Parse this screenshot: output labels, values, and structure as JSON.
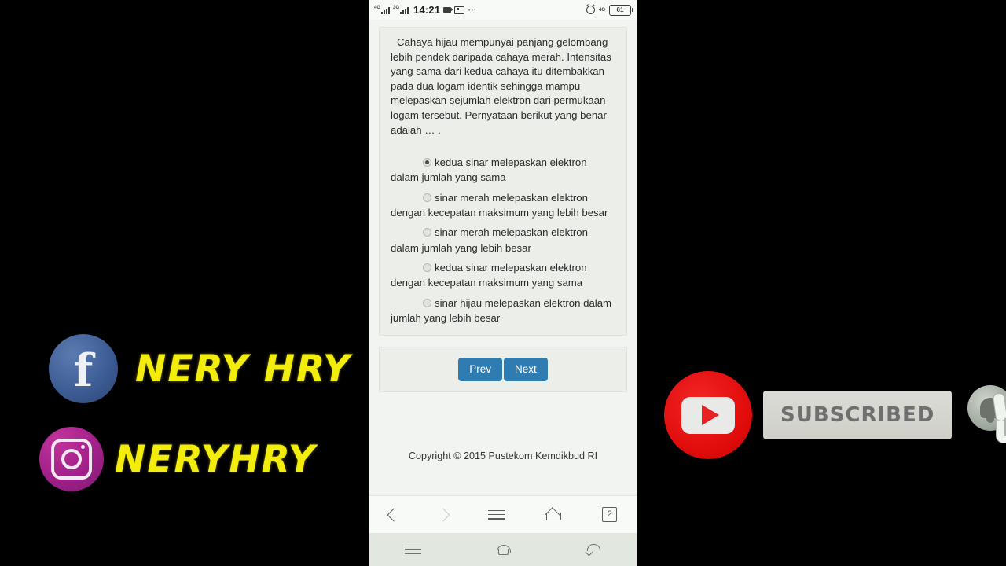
{
  "statusbar": {
    "sim1_network": "4G",
    "sim2_network": "3G",
    "clock": "14:21",
    "overflow_dots": "⋯",
    "right_network": "4G",
    "battery_percent": "61"
  },
  "quiz": {
    "question": "Cahaya hijau mempunyai panjang gelombang lebih pendek daripada cahaya merah. Intensitas yang sama dari kedua cahaya itu ditembakkan pada dua logam identik sehingga mampu melepaskan sejumlah elektron dari permukaan logam tersebut. Pernyataan berikut yang benar adalah … .",
    "options": [
      {
        "text": "kedua sinar melepaskan elektron dalam jumlah yang sama",
        "selected": true
      },
      {
        "text": "sinar merah melepaskan elektron dengan kecepatan maksimum yang lebih besar",
        "selected": false
      },
      {
        "text": "sinar merah melepaskan elektron dalam jumlah yang lebih besar",
        "selected": false
      },
      {
        "text": "kedua sinar melepaskan elektron dengan kecepatan maksimum yang sama",
        "selected": false
      },
      {
        "text": "sinar hijau melepaskan elektron dalam jumlah yang lebih besar",
        "selected": false
      }
    ],
    "prev_label": "Prev",
    "next_label": "Next",
    "copyright": "Copyright © 2015 Pustekom Kemdikbud RI",
    "button_color": "#2e7cb1"
  },
  "browser_bar": {
    "back_icon": "chevron-left-icon",
    "forward_icon": "chevron-right-icon",
    "menu_icon": "hamburger-icon",
    "home_icon": "home-icon",
    "tab_count": "2"
  },
  "android_nav": {
    "menu_icon": "menu-icon",
    "home_icon": "home-icon",
    "back_icon": "back-icon"
  },
  "watermarks": {
    "facebook": {
      "icon": "facebook-icon",
      "glyph": "f",
      "handle": "NERY HRY",
      "color": "#f2ed0c"
    },
    "instagram": {
      "icon": "instagram-icon",
      "handle": "NERYHRY",
      "color": "#f2ed0c"
    }
  },
  "youtube_overlay": {
    "logo_icon": "youtube-icon",
    "subscribed_label": "SUBSCRIBED",
    "bell_icon": "notification-bell-icon",
    "cursor_icon": "hand-cursor-icon"
  }
}
